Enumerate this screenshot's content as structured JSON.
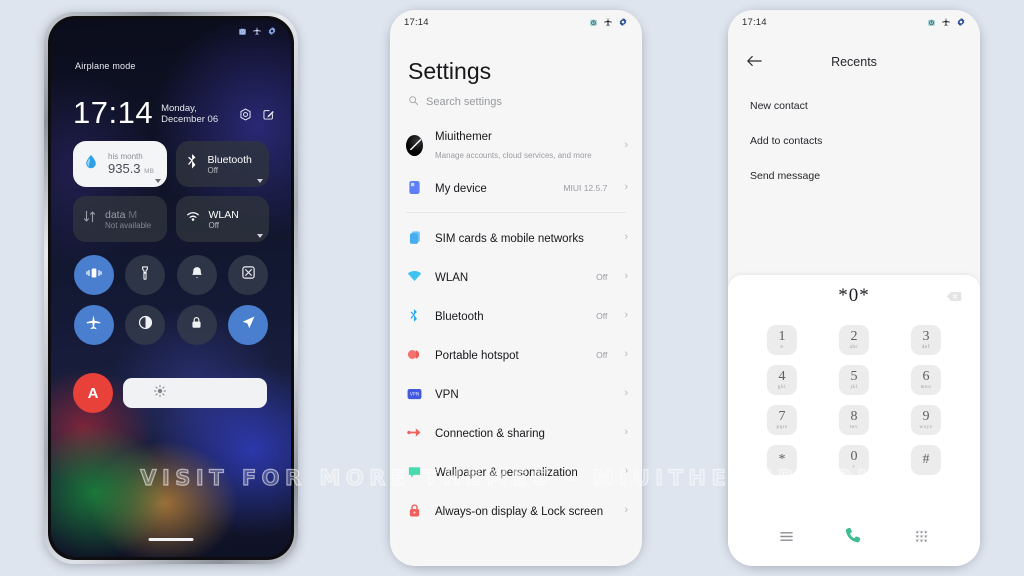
{
  "watermark": "VISIT FOR MORE THEMES - MIUITHEMER.COM",
  "theme": {
    "page_background": "#dfe5ee",
    "accent_blue": "#4a7fd0",
    "alert_red": "#e8413a",
    "call_green": "#3fbd92",
    "settings_bg": "#f6f6f7"
  },
  "lockscreen": {
    "status_bar": {
      "left_text": "Airplane mode",
      "icons": [
        "alarm-icon",
        "airplane-icon",
        "gear-icon"
      ]
    },
    "clock": {
      "time": "17:14",
      "date": "Monday, December 06",
      "icons": [
        "camera-shutter-icon",
        "edit-icon"
      ]
    },
    "big_tiles": [
      {
        "id": "data-usage",
        "icon": "water-drop-icon",
        "title": "935.3",
        "unit": "MB",
        "sub": "his month",
        "state": "active",
        "caret": true
      },
      {
        "id": "bluetooth",
        "icon": "bluetooth-icon",
        "title": "Bluetooth",
        "sub": "Off",
        "state": "normal",
        "caret": true
      },
      {
        "id": "mobile-data",
        "icon": "data-arrows-icon",
        "title": "data",
        "title_faded": "M",
        "sub": "Not available",
        "state": "dim",
        "caret": false
      },
      {
        "id": "wlan",
        "icon": "wifi-icon",
        "title": "WLAN",
        "sub": "Off",
        "state": "normal",
        "caret": true
      }
    ],
    "toggles": [
      {
        "id": "vibrate",
        "icon": "vibrate-icon",
        "state": "on"
      },
      {
        "id": "flashlight",
        "icon": "flashlight-icon",
        "state": "off"
      },
      {
        "id": "ringtone",
        "icon": "bell-icon",
        "state": "off"
      },
      {
        "id": "screenshot",
        "icon": "screenshot-icon",
        "state": "off"
      },
      {
        "id": "airplane",
        "icon": "airplane-icon",
        "state": "on"
      },
      {
        "id": "dark-mode",
        "icon": "contrast-icon",
        "state": "off"
      },
      {
        "id": "lock",
        "icon": "lock-icon",
        "state": "off"
      },
      {
        "id": "location",
        "icon": "navigation-icon",
        "state": "on"
      },
      {
        "id": "auto-brightness",
        "icon": "letter-a-icon",
        "state": "alert",
        "label": "A"
      }
    ],
    "brightness": {
      "icon": "brightness-sun-icon",
      "level_percent": 72
    },
    "home_handle": true
  },
  "settings": {
    "status_bar": {
      "time": "17:14",
      "icons": [
        "alarm-icon",
        "airplane-icon",
        "gear-icon"
      ]
    },
    "title": "Settings",
    "search": {
      "placeholder": "Search settings",
      "icon": "search-icon"
    },
    "groups": [
      {
        "rows": [
          {
            "id": "account",
            "icon": "avatar-miuithemer",
            "label": "Miuithemer",
            "sub": "Manage accounts, cloud services, and more",
            "value": "",
            "chevron": "›"
          },
          {
            "id": "my-device",
            "icon": "device-icon",
            "label": "My device",
            "sub": "",
            "value": "MIUI 12.5.7",
            "chevron": "›"
          }
        ]
      },
      {
        "rows": [
          {
            "id": "sim-cards",
            "icon": "sim-card-icon",
            "label": "SIM cards & mobile networks",
            "sub": "",
            "value": "",
            "chevron": "›"
          },
          {
            "id": "wlan",
            "icon": "wifi-icon",
            "label": "WLAN",
            "sub": "",
            "value": "Off",
            "chevron": "›"
          },
          {
            "id": "bluetooth",
            "icon": "bluetooth-icon",
            "label": "Bluetooth",
            "sub": "",
            "value": "Off",
            "chevron": "›"
          },
          {
            "id": "portable-hotspot",
            "icon": "hotspot-icon",
            "label": "Portable hotspot",
            "sub": "",
            "value": "Off",
            "chevron": "›"
          },
          {
            "id": "vpn",
            "icon": "vpn-icon",
            "label": "VPN",
            "sub": "",
            "value": "",
            "chevron": "›"
          },
          {
            "id": "connection-sharing",
            "icon": "connection-sharing-icon",
            "label": "Connection & sharing",
            "sub": "",
            "value": "",
            "chevron": "›"
          },
          {
            "id": "wallpaper",
            "icon": "wallpaper-icon",
            "label": "Wallpaper & personalization",
            "sub": "",
            "value": "",
            "chevron": "›"
          },
          {
            "id": "always-on-display",
            "icon": "lock-icon",
            "label": "Always-on display & Lock screen",
            "sub": "",
            "value": "",
            "chevron": "›"
          }
        ]
      }
    ]
  },
  "dialer": {
    "status_bar": {
      "time": "17:14",
      "icons": [
        "alarm-icon",
        "airplane-icon",
        "gear-icon"
      ]
    },
    "header": {
      "back_icon": "arrow-left-icon",
      "title": "Recents"
    },
    "menu_items": [
      {
        "id": "new-contact",
        "label": "New contact"
      },
      {
        "id": "add-to-contacts",
        "label": "Add to contacts"
      },
      {
        "id": "send-message",
        "label": "Send message"
      }
    ],
    "number_display": "*0*",
    "delete_icon": "backspace-icon",
    "keypad": [
      {
        "num": "1",
        "letters": "∞"
      },
      {
        "num": "2",
        "letters": "abc"
      },
      {
        "num": "3",
        "letters": "def"
      },
      {
        "num": "4",
        "letters": "ghi"
      },
      {
        "num": "5",
        "letters": "jkl"
      },
      {
        "num": "6",
        "letters": "mno"
      },
      {
        "num": "7",
        "letters": "pqrs"
      },
      {
        "num": "8",
        "letters": "tuv"
      },
      {
        "num": "9",
        "letters": "wxyz"
      },
      {
        "num": "*",
        "letters": ""
      },
      {
        "num": "0",
        "letters": "+"
      },
      {
        "num": "#",
        "letters": ""
      }
    ],
    "bottom_bar": [
      {
        "id": "menu",
        "icon": "menu-lines-icon"
      },
      {
        "id": "call",
        "icon": "phone-call-icon"
      },
      {
        "id": "keypad",
        "icon": "keypad-grid-icon"
      }
    ]
  }
}
